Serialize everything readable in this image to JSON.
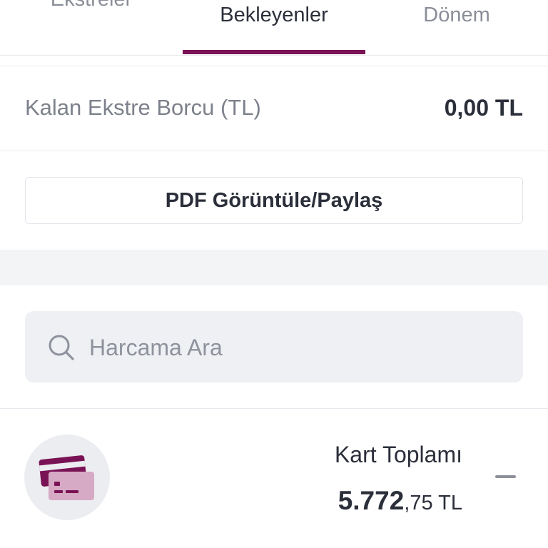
{
  "tabs": {
    "ekstreler": "Ekstreler",
    "bekleyenler": "Bekleyenler",
    "donem": "Dönem",
    "active": "Bekleyenler"
  },
  "balance": {
    "label": "Kalan Ekstre Borcu (TL)",
    "value": "0,00 TL"
  },
  "pdf_button": {
    "label": "PDF Görüntüle/Paylaş"
  },
  "search": {
    "placeholder": "Harcama Ara",
    "icon": "search-icon"
  },
  "card_total": {
    "label": "Kart Toplamı",
    "amount_main": "5.772",
    "amount_decimal": ",75",
    "currency": " TL",
    "icon": "credit-card-icon"
  },
  "colors": {
    "accent": "#7a1355",
    "card_primary": "#7a1355",
    "card_secondary": "#d6a9c4",
    "search_bg": "#eff0f4",
    "section_gap": "#f3f4f6"
  }
}
